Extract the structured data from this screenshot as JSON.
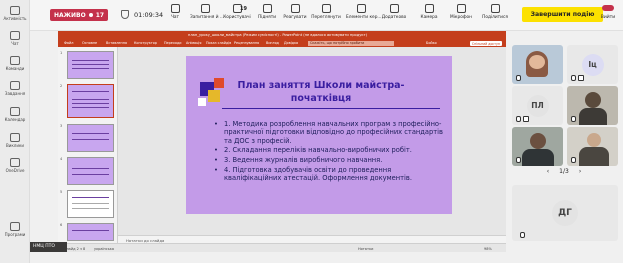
{
  "rail": {
    "items": [
      {
        "label": "Активність",
        "active": false
      },
      {
        "label": "Чат",
        "active": false
      },
      {
        "label": "Команди",
        "active": false
      },
      {
        "label": "Завдання",
        "active": false
      },
      {
        "label": "Календар",
        "active": false
      },
      {
        "label": "Виклики",
        "active": false
      },
      {
        "label": "OneDrive",
        "active": false
      },
      {
        "label": "Програми",
        "active": false
      }
    ]
  },
  "meeting": {
    "rec_label": "НАЖИВО",
    "rec_count": "17",
    "timer": "01:09:34",
    "toolbar": [
      {
        "label": "Чат",
        "icon": "chat-icon"
      },
      {
        "label": "Запитання й ...",
        "icon": "qa-icon"
      },
      {
        "label": "Користувачі",
        "icon": "people-icon",
        "count": "19"
      },
      {
        "label": "Підняти",
        "icon": "raise-hand-icon"
      },
      {
        "label": "Реагувати",
        "icon": "react-icon"
      },
      {
        "label": "Переглянути",
        "icon": "view-icon"
      },
      {
        "label": "Елементи кер...",
        "icon": "controls-icon"
      },
      {
        "label": "Додатково",
        "icon": "more-icon"
      },
      {
        "label": "Камера",
        "icon": "camera-icon"
      },
      {
        "label": "Мікрофон",
        "icon": "mic-icon"
      },
      {
        "label": "Поділитися",
        "icon": "share-icon"
      }
    ],
    "end_button": "Завершити подію",
    "leave_label": "Вийти",
    "presenter_name": "НМЦ ПТО"
  },
  "ppt": {
    "title": "план_уроку_школи_майстра (Режим сумісності) - PowerPoint (не вдалося активувати продукт)",
    "search_placeholder": "Скажіть, що потрібно зробити",
    "menu": [
      "Файл",
      "Основне",
      "Вставлення",
      "Конструктор",
      "Переходи",
      "Анімація",
      "Показ слайдів",
      "Рецензування",
      "Вигляд",
      "Довідка"
    ],
    "account": "Бойко",
    "share": "Спільний доступ",
    "notes_placeholder": "Нотатки до слайда",
    "status": {
      "slide": "Слайд 2 з 8",
      "language": "українська",
      "notes": "Нотатки",
      "zoom": "98%"
    }
  },
  "slide": {
    "title": "План заняття Школи майстра-початківця",
    "bullets": [
      "1. Методика розроблення навчальних програм з професійно-практичної підготовки відповідно до професійних стандартів та ДОС з професій.",
      "2. Складання переліків навчально-виробничих робіт.",
      "3. Ведення журналів виробничого навчання.",
      "4. Підготовка здобувачів освіти до проведення кваліфікаційних атестацій. Оформлення документів."
    ]
  },
  "participants": {
    "tiles": [
      {
        "initials": "",
        "kind": "photo"
      },
      {
        "initials": "Іц",
        "kind": "avatar"
      },
      {
        "initials": "ПЛ",
        "kind": "avatar"
      },
      {
        "initials": "",
        "kind": "photo"
      },
      {
        "initials": "",
        "kind": "photo"
      },
      {
        "initials": "",
        "kind": "photo"
      },
      {
        "initials": "ДГ",
        "kind": "avatar"
      }
    ],
    "pager": "1/3"
  },
  "colors": {
    "accent": "#5b5fc7",
    "end_button": "#fce100",
    "live": "#c4314b",
    "ppt_red": "#c43e1c",
    "slide_bg": "#c39be8",
    "slide_title": "#3a1ea0"
  }
}
